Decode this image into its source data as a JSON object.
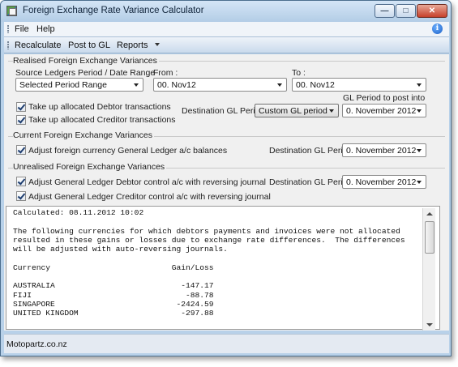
{
  "window": {
    "title": "Foreign Exchange Rate Variance Calculator"
  },
  "menu": {
    "file": "File",
    "help": "Help"
  },
  "toolbar": {
    "recalculate": "Recalculate",
    "post_to_gl": "Post to GL",
    "reports": "Reports"
  },
  "realised": {
    "section_label": "Realised Foreign Exchange Variances",
    "source_label": "Source Ledgers Period / Date Range",
    "source_value": "Selected Period Range",
    "from_label": "From :",
    "from_value": "00. Nov12",
    "to_label": "To :",
    "to_value": "00. Nov12",
    "debtor_check_label": "Take up allocated Debtor transactions",
    "debtor_checked": true,
    "creditor_check_label": "Take up allocated Creditor transactions",
    "creditor_checked": true,
    "dest_gl_period_label": "Destination GL Period:",
    "dest_gl_period_value": "Custom GL period",
    "gl_post_label": "GL Period to post into",
    "gl_post_value": "0. November 2012"
  },
  "current": {
    "section_label": "Current Foreign Exchange Variances",
    "adjust_label": "Adjust foreign currency General Ledger a/c balances",
    "adjust_checked": true,
    "dest_label": "Destination GL Period",
    "dest_value": "0. November 2012"
  },
  "unrealised": {
    "section_label": "Unrealised Foreign Exchange Variances",
    "debtor_label": "Adjust General Ledger Debtor control a/c with reversing journal",
    "debtor_checked": true,
    "creditor_label": "Adjust General Ledger Creditor control a/c with reversing journal",
    "creditor_checked": true,
    "dest_label": "Destination GL Period",
    "dest_value": "0. November 2012"
  },
  "report": {
    "text": "Calculated: 08.11.2012 10:02\n\nThe following currencies for which debtors payments and invoices were not allocated\nresulted in these gains or losses due to exchange rate differences.  The differences\nwill be adjusted with auto-reversing journals.\n\nCurrency                          Gain/Loss\n\nAUSTRALIA                           -147.17\nFIJI                                 -88.78\nSINGAPORE                          -2424.59\nUNITED KINGDOM                      -297.88"
  },
  "status": {
    "text": "Motopartz.co.nz"
  }
}
